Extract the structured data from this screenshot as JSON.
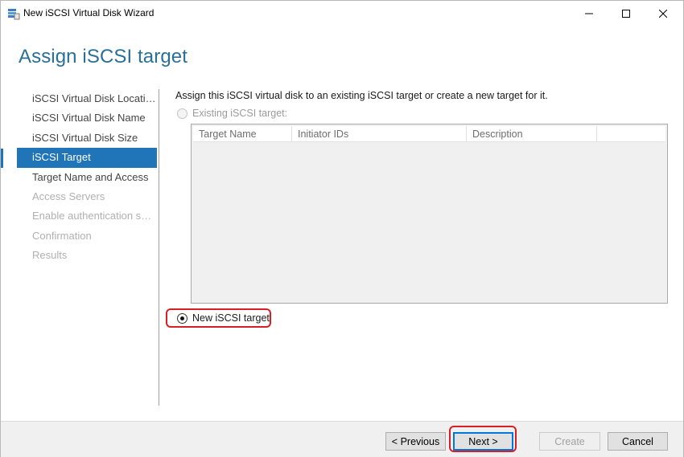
{
  "window": {
    "title": "New iSCSI Virtual Disk Wizard"
  },
  "header": {
    "title": "Assign iSCSI target"
  },
  "nav": {
    "items": [
      {
        "label": "iSCSI Virtual Disk Location",
        "state": "enabled"
      },
      {
        "label": "iSCSI Virtual Disk Name",
        "state": "enabled"
      },
      {
        "label": "iSCSI Virtual Disk Size",
        "state": "enabled"
      },
      {
        "label": "iSCSI Target",
        "state": "selected"
      },
      {
        "label": "Target Name and Access",
        "state": "enabled"
      },
      {
        "label": "Access Servers",
        "state": "disabled"
      },
      {
        "label": "Enable authentication ser...",
        "state": "disabled"
      },
      {
        "label": "Confirmation",
        "state": "disabled"
      },
      {
        "label": "Results",
        "state": "disabled"
      }
    ]
  },
  "main": {
    "instructions": "Assign this iSCSI virtual disk to an existing iSCSI target or create a new target for it.",
    "existing_option": {
      "label": "Existing iSCSI target:",
      "checked": false,
      "enabled": false
    },
    "table": {
      "columns": [
        "Target Name",
        "Initiator IDs",
        "Description",
        ""
      ],
      "rows": []
    },
    "new_option": {
      "label": "New iSCSI target",
      "checked": true
    }
  },
  "footer": {
    "previous_label": "< Previous",
    "next_label": "Next >",
    "create_label": "Create",
    "cancel_label": "Cancel"
  },
  "colors": {
    "accent": "#1f75b8",
    "title": "#2a6f97",
    "highlight": "#d81f26"
  }
}
